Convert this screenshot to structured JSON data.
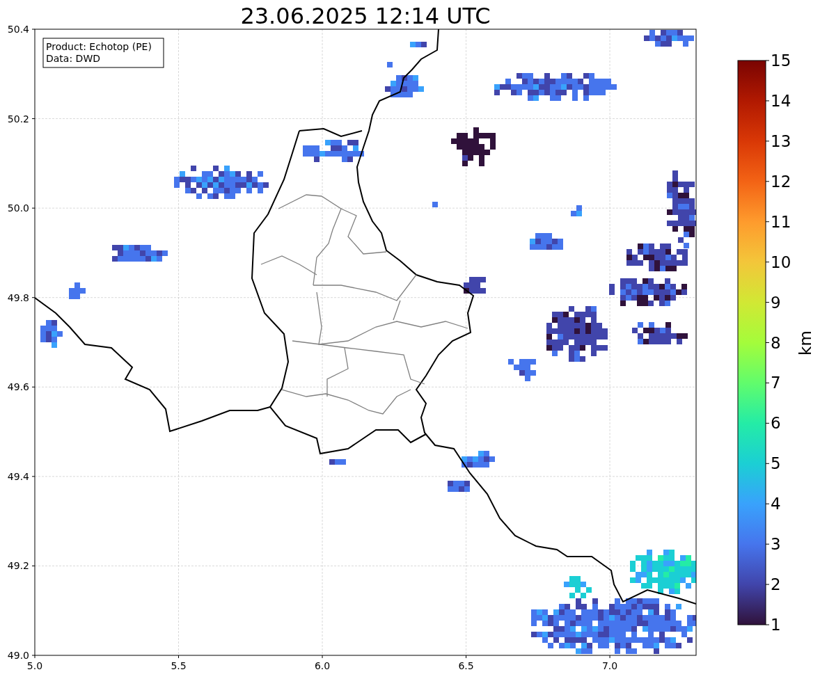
{
  "title": "23.06.2025 12:14 UTC",
  "info_box": [
    "Product: Echotop (PE)",
    "Data: DWD"
  ],
  "y_ticks": [
    "50.4",
    "50.2",
    "50.0",
    "49.8",
    "49.6",
    "49.4",
    "49.2",
    "49.0"
  ],
  "x_ticks": [
    "5.0",
    "5.5",
    "6.0",
    "6.5",
    "7.0"
  ],
  "colorbar": {
    "label": "km",
    "ticks": [
      "15",
      "14",
      "13",
      "12",
      "11",
      "10",
      "9",
      "8",
      "7",
      "6",
      "5",
      "4",
      "3",
      "2",
      "1"
    ]
  }
}
